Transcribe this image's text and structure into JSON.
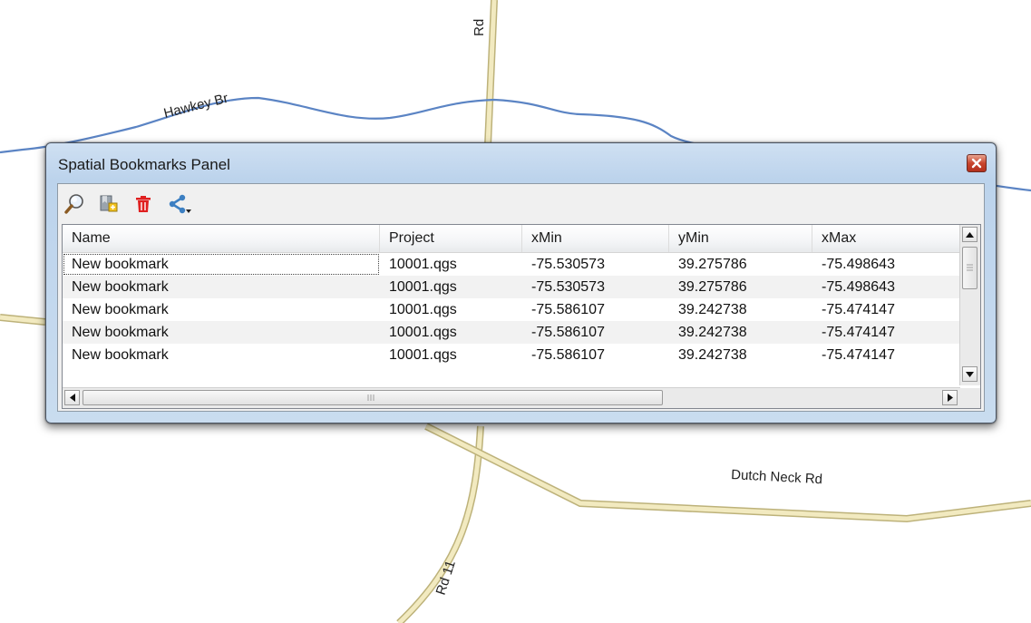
{
  "map": {
    "labels": {
      "hawkey": "Hawkey Br",
      "rd_top": "Rd",
      "dutch_neck": "Dutch Neck Rd",
      "rd11": "Rd 11"
    }
  },
  "panel": {
    "title": "Spatial Bookmarks Panel",
    "toolbar": [
      {
        "name": "zoom-to-bookmark",
        "icon": "magnifier-icon"
      },
      {
        "name": "new-bookmark",
        "icon": "add-bookmark-icon"
      },
      {
        "name": "delete-bookmark",
        "icon": "trash-icon"
      },
      {
        "name": "share-bookmarks",
        "icon": "share-icon"
      }
    ],
    "table": {
      "columns": [
        "Name",
        "Project",
        "xMin",
        "yMin",
        "xMax"
      ],
      "rows": [
        [
          "New bookmark",
          "10001.qgs",
          "-75.530573",
          "39.275786",
          "-75.498643"
        ],
        [
          "New bookmark",
          "10001.qgs",
          "-75.530573",
          "39.275786",
          "-75.498643"
        ],
        [
          "New bookmark",
          "10001.qgs",
          "-75.586107",
          "39.242738",
          "-75.474147"
        ],
        [
          "New bookmark",
          "10001.qgs",
          "-75.586107",
          "39.242738",
          "-75.474147"
        ],
        [
          "New bookmark",
          "10001.qgs",
          "-75.586107",
          "39.242738",
          "-75.474147"
        ]
      ]
    }
  },
  "colors": {
    "river": "#5b84c4",
    "road": "#f2eac0",
    "road_edge": "#bdb27a",
    "close_button": "#c8452d",
    "delete_icon": "#e02020"
  }
}
